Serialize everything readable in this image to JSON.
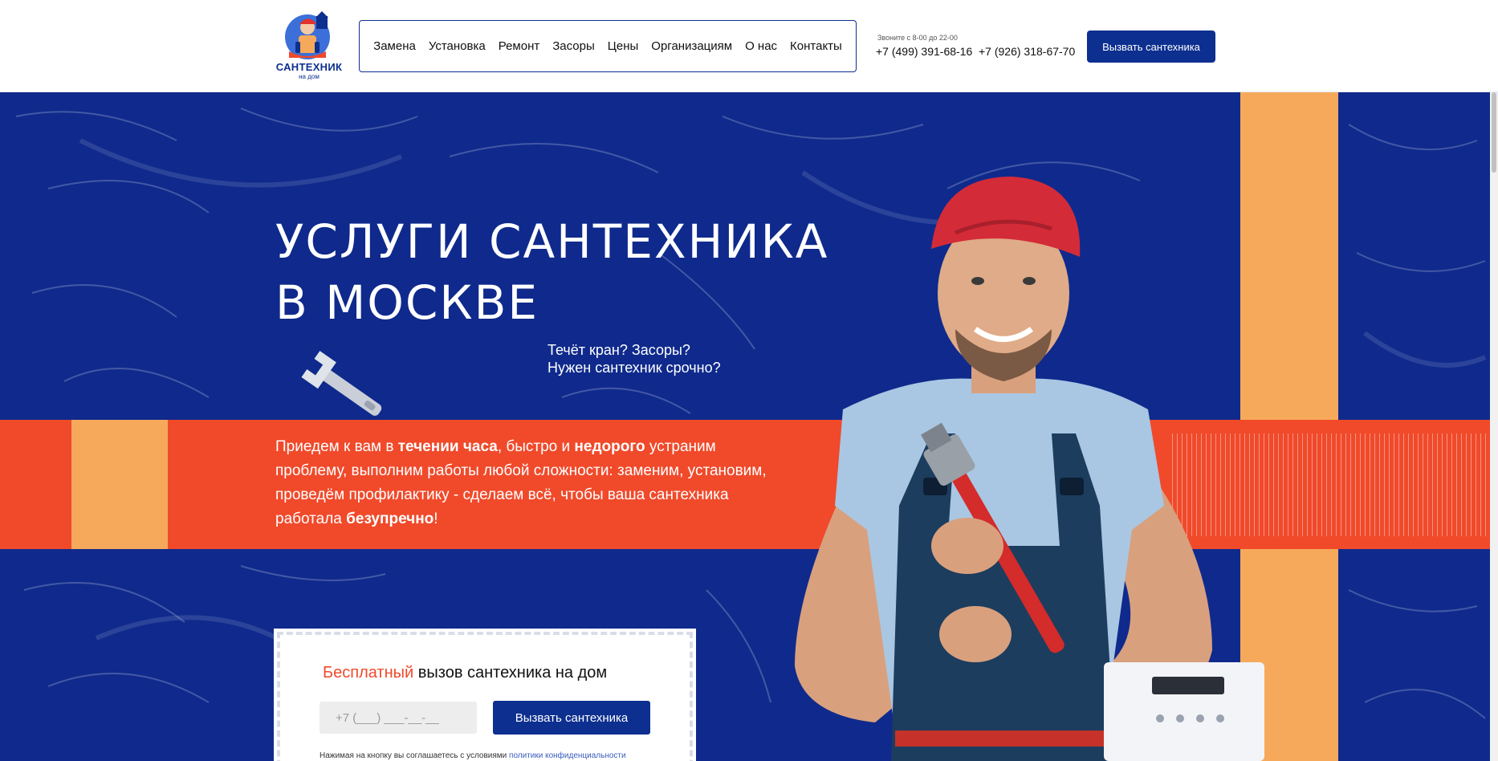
{
  "header": {
    "logo_title": "САНТЕХНИК",
    "logo_sub": "на дом",
    "nav": [
      "Замена",
      "Установка",
      "Ремонт",
      "Засоры",
      "Цены",
      "Организациям",
      "О нас",
      "Контакты"
    ],
    "hours": "Звоните с 8-00 до 22-00",
    "phone1": "+7 (499) 391-68-16",
    "phone2": "+7 (926) 318-67-70",
    "call_button": "Вызвать сантехника"
  },
  "hero": {
    "title_line1": "УСЛУГИ САНТЕХНИКА",
    "title_line2": "В МОСКВЕ",
    "sub_line1": "Течёт кран? Засоры?",
    "sub_line2": "Нужен сантехник срочно?",
    "desc": {
      "p1": "Приедем к вам в ",
      "b1": "течении часа",
      "p2": ", быстро и ",
      "b2": "недорого",
      "p3": " устраним проблему, выполним работы любой сложности: заменим, установим, проведём профилактику - сделаем всё, чтобы ваша сантехника работала ",
      "b3": "безупречно",
      "p4": "!"
    }
  },
  "form": {
    "heading_accent": "Бесплатный",
    "heading_rest": " вызов сантехника на дом",
    "phone_placeholder": "+7 (___) ___-__-__",
    "button": "Вызвать сантехника",
    "note": "Нажимая на кнопку вы соглашаетесь с условиями",
    "note_link": "политики конфиденциальности"
  },
  "colors": {
    "brand_blue": "#0d2f8f",
    "hero_blue": "#0f2a8c",
    "orange": "#f04a2b",
    "yellow": "#f7a95b"
  }
}
